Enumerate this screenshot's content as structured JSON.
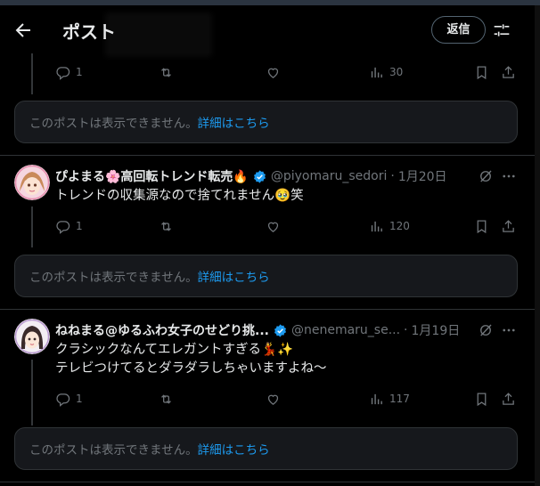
{
  "header": {
    "title": "ポスト",
    "reply_label": "返信"
  },
  "unavailable": {
    "text": "このポストは表示できません。",
    "link": "詳細はこちら"
  },
  "post0": {
    "reply_count": "1",
    "retweet_count": "",
    "like_count": "",
    "view_count": "30"
  },
  "post1": {
    "name": "ぴよまる🌸高回転トレンド転売🔥",
    "handle": "@piyomaru_sedori",
    "separator": "·",
    "date": "1月20日",
    "text": "トレンドの収集源なので捨てれません🥹笑",
    "reply_count": "1",
    "view_count": "120"
  },
  "post2": {
    "name": "ねねまる@ゆるふわ女子のせどり挑...",
    "handle": "@nenemaru_se...",
    "separator": "·",
    "date": "1月19日",
    "text_line1": "クラシックなんてエレガントすぎる💃✨",
    "text_line2": "テレビつけてるとダラダラしちゃいますよね～",
    "reply_count": "1",
    "view_count": "117"
  },
  "colors": {
    "accent": "#1d9bf0",
    "muted": "#71767b",
    "text": "#e7e9ea",
    "background": "#000000",
    "card": "#16181c"
  }
}
